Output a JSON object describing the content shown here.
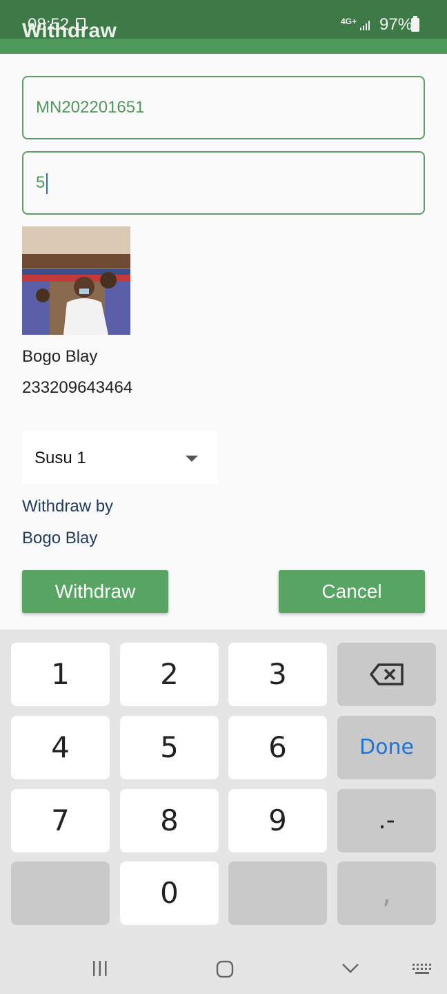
{
  "status_bar": {
    "time": "08:52",
    "network": "4G+",
    "battery": "97%"
  },
  "app_bar": {
    "title": "Withdraw"
  },
  "form": {
    "account_field_value": "MN202201651",
    "amount_field_value": "5",
    "customer_name": "Bogo Blay",
    "customer_phone": "233209643464",
    "account_type_selected": "Susu 1",
    "withdraw_by_label": "Withdraw by",
    "withdraw_by_name": "Bogo Blay",
    "withdraw_button": "Withdraw",
    "cancel_button": "Cancel"
  },
  "keyboard": {
    "keys": [
      "1",
      "2",
      "3",
      "4",
      "5",
      "6",
      "7",
      "8",
      "9",
      "0"
    ],
    "done_label": "Done",
    "symbol_key": ".-",
    "comma_key": ","
  },
  "colors": {
    "primary": "#4f9a5a",
    "status_bar": "#3d7a47",
    "accent_text": "#1f3a5c",
    "done_blue": "#1e73d8"
  }
}
